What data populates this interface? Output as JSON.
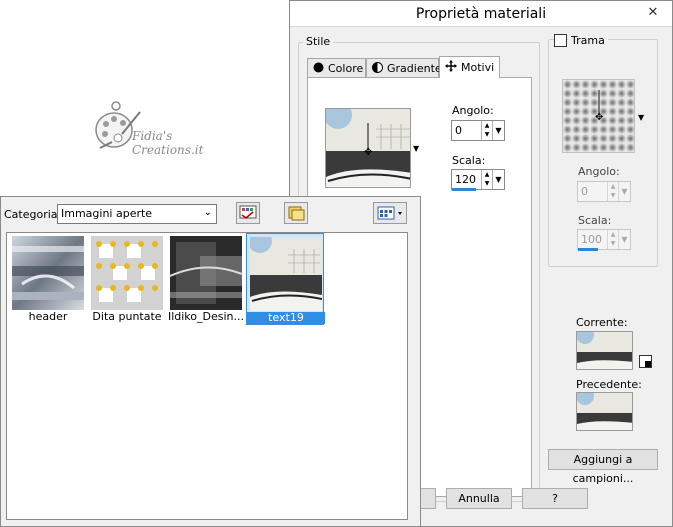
{
  "dialog": {
    "title": "Proprietà materiali",
    "close_glyph": "✕",
    "style_group": "Stile",
    "tabs": [
      {
        "label": "Colore",
        "icon": "filled-circle-icon"
      },
      {
        "label": "Gradiente",
        "icon": "half-circle-icon"
      },
      {
        "label": "Motivi",
        "icon": "move-arrows-icon"
      }
    ],
    "pattern": {
      "angle_label": "Angolo:",
      "angle_value": "0",
      "scale_label": "Scala:",
      "scale_value": "120"
    },
    "texture": {
      "checkbox_label": "Trama",
      "checked": false,
      "angle_label": "Angolo:",
      "angle_value": "0",
      "scale_label": "Scala:",
      "scale_value": "100"
    },
    "current_label": "Corrente:",
    "previous_label": "Precedente:",
    "add_button": "Aggiungi a campioni...",
    "cancel_button": "Annulla",
    "help_button": "?"
  },
  "logo": {
    "text": "Fidia's Creations.it"
  },
  "panel": {
    "category_label": "Categoria:",
    "category_value": "Immagini aperte",
    "items": [
      {
        "caption": "header",
        "selected": false
      },
      {
        "caption": "Dita puntate",
        "selected": false
      },
      {
        "caption": "Ildiko_Desin...",
        "selected": false
      },
      {
        "caption": "text19",
        "selected": true
      }
    ]
  },
  "colors": {
    "accent": "#2f8de4",
    "selection_bg": "#cde6fb",
    "dialog_bg": "#f0f0f0"
  }
}
